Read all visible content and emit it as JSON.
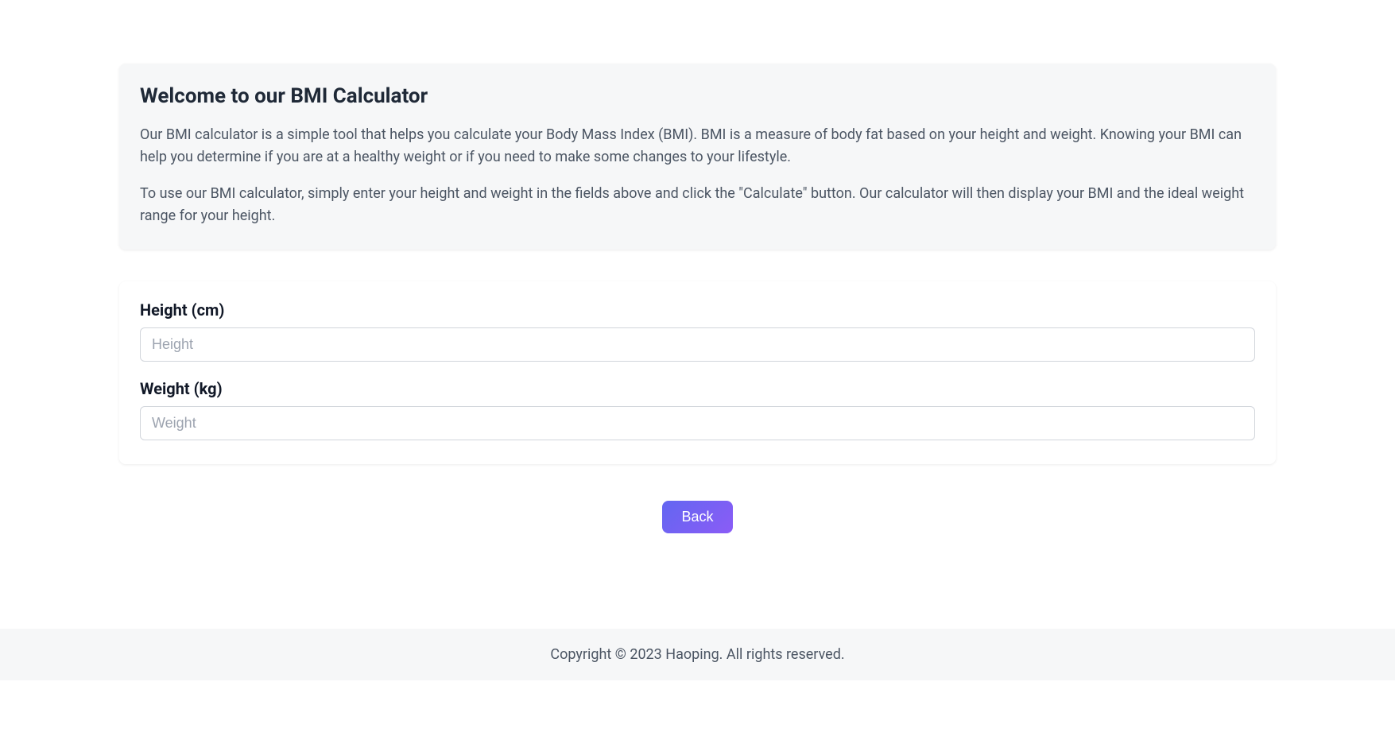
{
  "intro": {
    "title": "Welcome to our BMI Calculator",
    "paragraph1": "Our BMI calculator is a simple tool that helps you calculate your Body Mass Index (BMI). BMI is a measure of body fat based on your height and weight. Knowing your BMI can help you determine if you are at a healthy weight or if you need to make some changes to your lifestyle.",
    "paragraph2": "To use our BMI calculator, simply enter your height and weight in the fields above and click the \"Calculate\" button. Our calculator will then display your BMI and the ideal weight range for your height."
  },
  "form": {
    "height": {
      "label": "Height (cm)",
      "placeholder": "Height",
      "value": ""
    },
    "weight": {
      "label": "Weight (kg)",
      "placeholder": "Weight",
      "value": ""
    }
  },
  "buttons": {
    "back": "Back"
  },
  "footer": {
    "copyright": "Copyright © 2023 Haoping. All rights reserved."
  }
}
